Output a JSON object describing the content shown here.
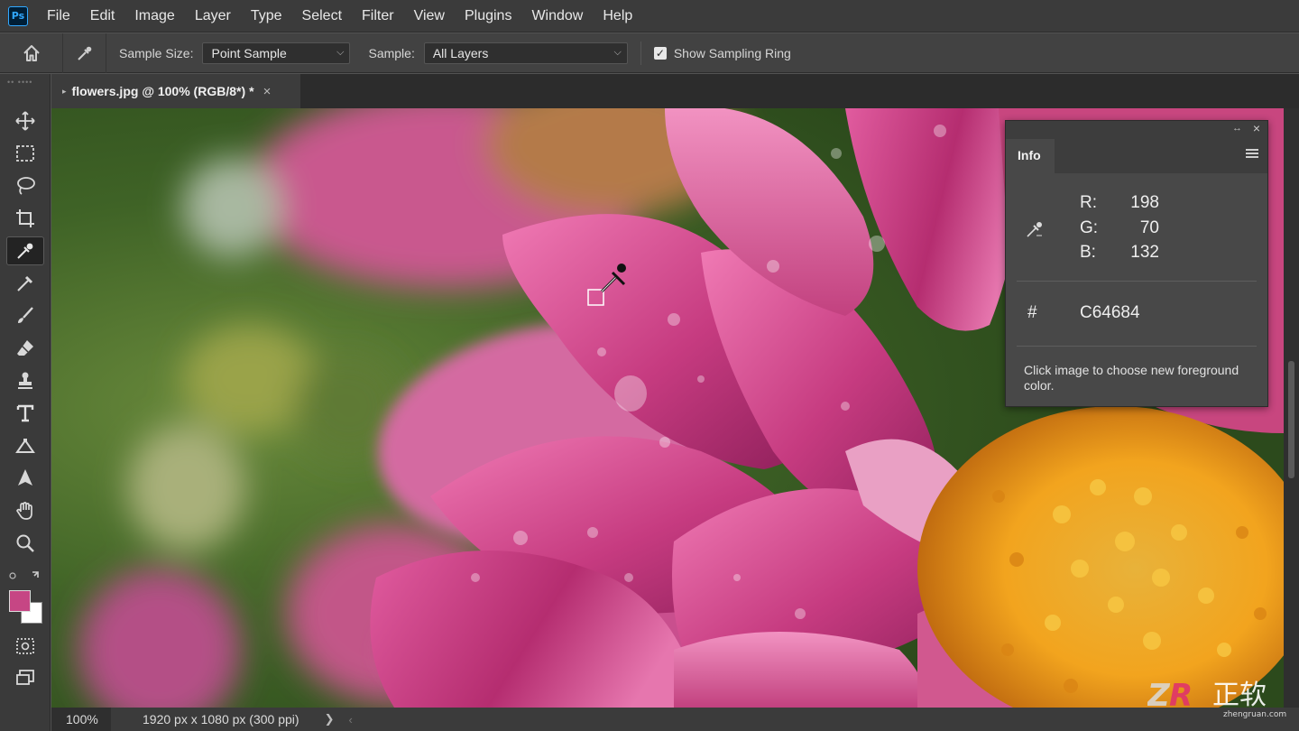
{
  "app": {
    "logo_text": "Ps"
  },
  "menu": [
    "File",
    "Edit",
    "Image",
    "Layer",
    "Type",
    "Select",
    "Filter",
    "View",
    "Plugins",
    "Window",
    "Help"
  ],
  "options_bar": {
    "sample_size_label": "Sample Size:",
    "sample_size_value": "Point Sample",
    "sample_label": "Sample:",
    "sample_value": "All Layers",
    "show_ring_label": "Show Sampling Ring",
    "show_ring_checked": true
  },
  "document_tab": {
    "title": "flowers.jpg @ 100% (RGB/8*)",
    "modified_mark": "*"
  },
  "tools": [
    "move-tool",
    "marquee-tool",
    "lasso-tool",
    "crop-tool",
    "eyedropper-tool",
    "color-sampler-tool",
    "brush-tool",
    "eraser-tool",
    "stamp-tool",
    "type-tool",
    "path-tool",
    "pen-tool",
    "hand-tool",
    "zoom-tool",
    "quick-mask",
    "screen-mode"
  ],
  "active_tool": "eyedropper-tool",
  "colors": {
    "foreground": "#C64684",
    "background": "#FFFFFF",
    "accent": "#31A8FF"
  },
  "info_panel": {
    "tab_label": "Info",
    "r_label": "R:",
    "r_value": "198",
    "g_label": "G:",
    "g_value": "70",
    "b_label": "B:",
    "b_value": "132",
    "hash_label": "#",
    "hex_value": "C64684",
    "hint": "Click image to choose new foreground color."
  },
  "status_bar": {
    "zoom": "100%",
    "doc_size": "1920 px x 1080 px (300 ppi)"
  },
  "watermark": {
    "text": "ZR 正软",
    "url_text": "zhengruan.com"
  }
}
